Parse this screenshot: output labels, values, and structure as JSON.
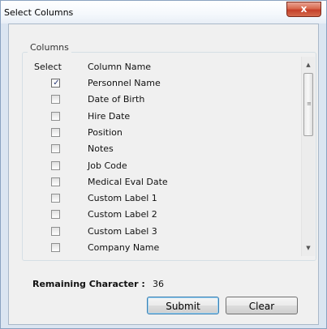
{
  "window": {
    "title": "Select Columns",
    "close_glyph": "x"
  },
  "columns_group": {
    "label": "Columns",
    "header_select": "Select",
    "header_column_name": "Column Name",
    "rows": [
      {
        "name": "Personnel Name",
        "checked": true
      },
      {
        "name": "Date of Birth",
        "checked": false
      },
      {
        "name": "Hire Date",
        "checked": false
      },
      {
        "name": "Position",
        "checked": false
      },
      {
        "name": "Notes",
        "checked": false
      },
      {
        "name": "Job Code",
        "checked": false
      },
      {
        "name": "Medical Eval Date",
        "checked": false
      },
      {
        "name": "Custom Label 1",
        "checked": false
      },
      {
        "name": "Custom Label 2",
        "checked": false
      },
      {
        "name": "Custom Label 3",
        "checked": false
      },
      {
        "name": "Company Name",
        "checked": false
      }
    ]
  },
  "icons": {
    "scroll_up": "scroll-up-arrow-icon",
    "scroll_down": "scroll-down-arrow-icon",
    "check": "checkmark-icon",
    "close": "close-icon"
  },
  "remaining": {
    "label": "Remaining Character :",
    "value": "36"
  },
  "buttons": {
    "submit": "Submit",
    "clear": "Clear"
  },
  "colors": {
    "frame": "#dbe5f1",
    "close_button": "#c5402a",
    "client_bg": "#f0f0f0"
  }
}
